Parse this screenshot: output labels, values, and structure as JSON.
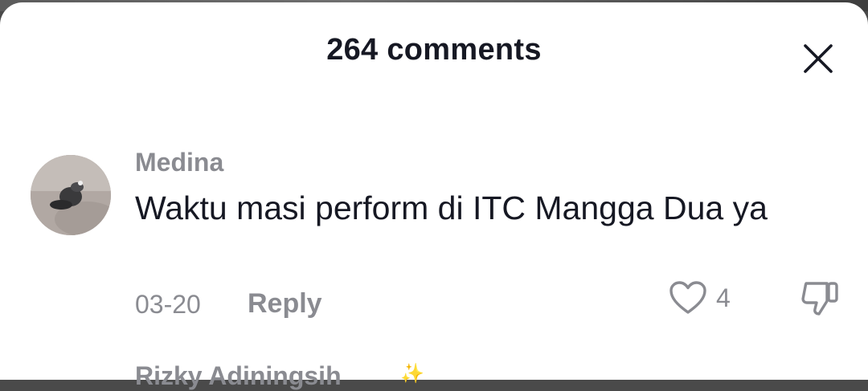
{
  "header": {
    "title": "264 comments",
    "close_icon": "close-icon"
  },
  "comment": {
    "username": "Medina",
    "text": "Waktu masi perform di ITC Mangga Dua ya",
    "date": "03-20",
    "reply_label": "Reply",
    "like_count": "4",
    "like_icon": "heart-outline-icon",
    "dislike_icon": "thumbs-down-icon"
  },
  "next_comment": {
    "username_partial": "Rizky Adiningsih",
    "emoji": "✨"
  },
  "colors": {
    "text_primary": "#161823",
    "text_secondary": "#8a8b91",
    "background": "#ffffff"
  }
}
